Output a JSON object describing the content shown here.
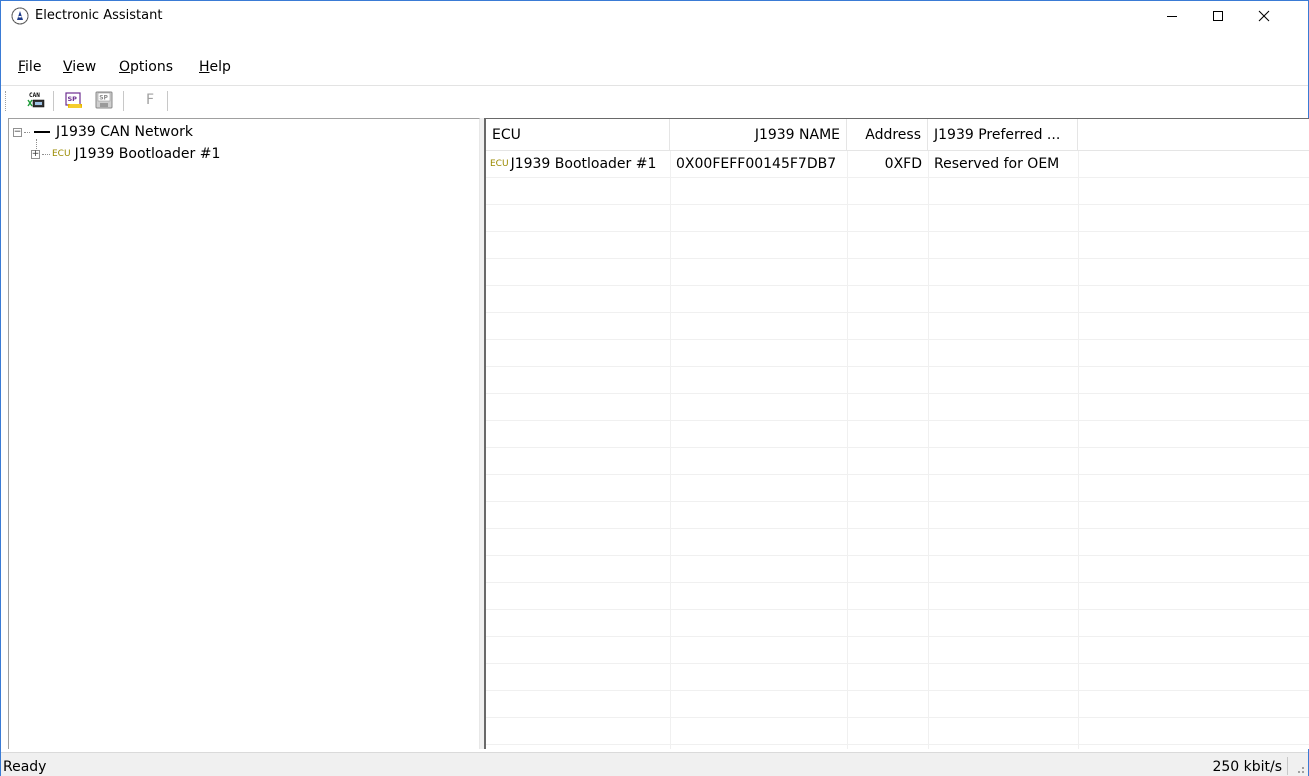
{
  "window": {
    "title": "Electronic Assistant",
    "icons": {
      "app": "assistant-logo-icon",
      "minimize": "minimize-icon",
      "maximize": "maximize-icon",
      "close": "close-icon"
    }
  },
  "menu": {
    "file": {
      "first": "F",
      "rest": "ile"
    },
    "view": {
      "first": "V",
      "rest": "iew"
    },
    "options": {
      "first": "O",
      "rest": "ptions"
    },
    "help": {
      "first": "H",
      "rest": "elp"
    }
  },
  "toolbar": {
    "can_label": "CAN",
    "sp_label_1": "SP",
    "sp_label_2": "SP",
    "f_label": "F"
  },
  "tree": {
    "root": {
      "label": "J1939 CAN Network",
      "expander": "−"
    },
    "children": [
      {
        "label": "J1939 Bootloader #1",
        "tag": "ECU",
        "expander": "+"
      }
    ]
  },
  "list": {
    "columns": [
      "ECU",
      "J1939 NAME",
      "Address",
      "J1939 Preferred ..."
    ],
    "rows": [
      {
        "tag": "ECU",
        "ecu": "J1939 Bootloader #1",
        "name": "0X00FEFF00145F7DB7",
        "address": "0XFD",
        "preferred": "Reserved for OEM"
      }
    ]
  },
  "status": {
    "text": "Ready",
    "rate": "250 kbit/s"
  }
}
